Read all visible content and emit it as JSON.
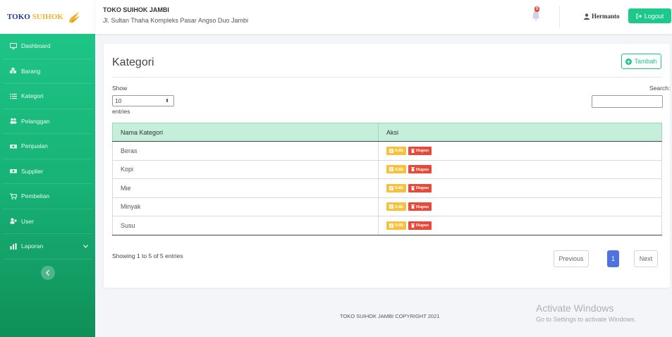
{
  "brand": {
    "name_part1": "TOKO",
    "name_part2": "SUIHOK"
  },
  "sidebar": {
    "items": [
      {
        "label": "Dashboard",
        "icon": "monitor-icon"
      },
      {
        "label": "Barang",
        "icon": "boxes-icon"
      },
      {
        "label": "Kategori",
        "icon": "list-icon"
      },
      {
        "label": "Pelanggan",
        "icon": "users-icon"
      },
      {
        "label": "Penjualan",
        "icon": "money-icon"
      },
      {
        "label": "Supplier",
        "icon": "money-icon"
      },
      {
        "label": "Pembelian",
        "icon": "cart-icon"
      },
      {
        "label": "User",
        "icon": "user-plus-icon"
      },
      {
        "label": "Laporan",
        "icon": "report-icon"
      }
    ],
    "toggle_icon": "chevron-left-icon"
  },
  "topbar": {
    "store_name": "TOKO SUIHOK JAMBI",
    "store_address": "Jl. Sultan Thaha Kompleks Pasar Angso Duo Jambi",
    "alert_count": "0",
    "user_name": "Hermanto",
    "logout_label": "Logout"
  },
  "card": {
    "title": "Kategori",
    "add_label": "Tambah",
    "show_label": "Show",
    "entries_label": "entries",
    "length_value": "10",
    "search_label": "Search:",
    "search_value": "",
    "table": {
      "headers": [
        "Nama Kategori",
        "Aksi"
      ],
      "edit_label": "Edit",
      "delete_label": "Hapus",
      "rows": [
        "Beras",
        "Kopi",
        "Mie",
        "Minyak",
        "Susu"
      ]
    },
    "info": "Showing 1 to 5 of 5 entries",
    "pagination": {
      "previous": "Previous",
      "current": "1",
      "next": "Next"
    }
  },
  "footer": {
    "copyright": "TOKO SUIHOK JAMBI COPYRIGHT 2021"
  },
  "watermark": {
    "line1": "Activate Windows",
    "line2": "Go to Settings to activate Windows."
  },
  "colors": {
    "sidebar": "#1cc88a",
    "primary": "#4e73df",
    "warning": "#f6c23e",
    "danger": "#e74a3b",
    "table_header": "#c5eedb"
  }
}
